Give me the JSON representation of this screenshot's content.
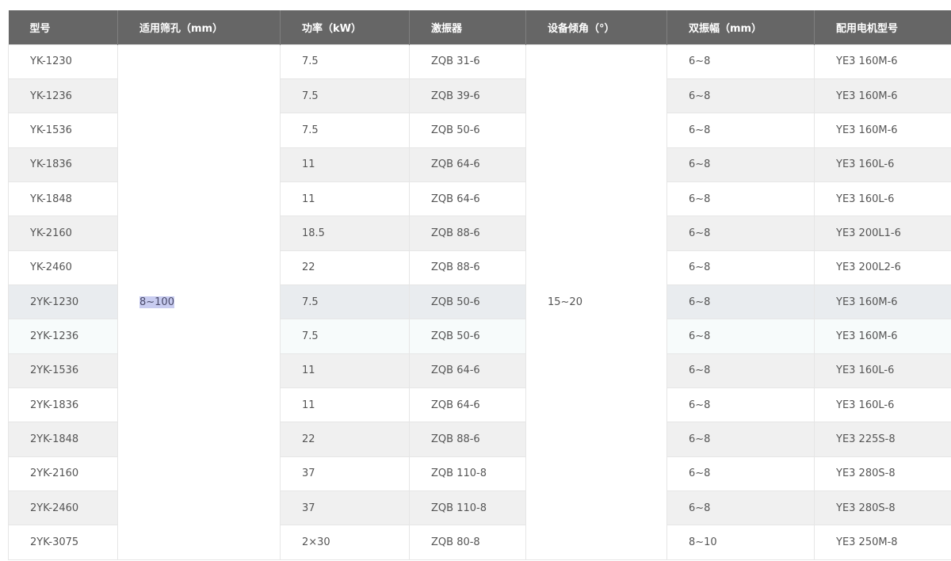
{
  "table": {
    "headers": [
      "型号",
      "适用筛孔（mm）",
      "功率（kW）",
      "激振器",
      "设备倾角（°）",
      "双振幅（mm）",
      "配用电机型号"
    ],
    "merged": {
      "mesh": "8~100",
      "angle": "15~20"
    },
    "rows": [
      {
        "model": "YK-1230",
        "power": "7.5",
        "exciter": "ZQB 31-6",
        "amplitude": "6~8",
        "motor": "YE3 160M-6"
      },
      {
        "model": "YK-1236",
        "power": "7.5",
        "exciter": "ZQB 39-6",
        "amplitude": "6~8",
        "motor": "YE3 160M-6"
      },
      {
        "model": "YK-1536",
        "power": "7.5",
        "exciter": "ZQB 50-6",
        "amplitude": "6~8",
        "motor": "YE3 160M-6"
      },
      {
        "model": "YK-1836",
        "power": "11",
        "exciter": "ZQB 64-6",
        "amplitude": "6~8",
        "motor": "YE3 160L-6"
      },
      {
        "model": "YK-1848",
        "power": "11",
        "exciter": "ZQB 64-6",
        "amplitude": "6~8",
        "motor": "YE3 160L-6"
      },
      {
        "model": "YK-2160",
        "power": "18.5",
        "exciter": "ZQB 88-6",
        "amplitude": "6~8",
        "motor": "YE3 200L1-6"
      },
      {
        "model": "YK-2460",
        "power": "22",
        "exciter": "ZQB 88-6",
        "amplitude": "6~8",
        "motor": "YE3 200L2-6"
      },
      {
        "model": "2YK-1230",
        "power": "7.5",
        "exciter": "ZQB 50-6",
        "amplitude": "6~8",
        "motor": "YE3 160M-6"
      },
      {
        "model": "2YK-1236",
        "power": "7.5",
        "exciter": "ZQB 50-6",
        "amplitude": "6~8",
        "motor": "YE3 160M-6"
      },
      {
        "model": "2YK-1536",
        "power": "11",
        "exciter": "ZQB 64-6",
        "amplitude": "6~8",
        "motor": "YE3 160L-6"
      },
      {
        "model": "2YK-1836",
        "power": "11",
        "exciter": "ZQB 64-6",
        "amplitude": "6~8",
        "motor": "YE3 160L-6"
      },
      {
        "model": "2YK-1848",
        "power": "22",
        "exciter": "ZQB 88-6",
        "amplitude": "6~8",
        "motor": "YE3 225S-8"
      },
      {
        "model": "2YK-2160",
        "power": "37",
        "exciter": "ZQB 110-8",
        "amplitude": "6~8",
        "motor": "YE3 280S-8"
      },
      {
        "model": "2YK-2460",
        "power": "37",
        "exciter": "ZQB 110-8",
        "amplitude": "6~8",
        "motor": "YE3 280S-8"
      },
      {
        "model": "2YK-3075",
        "power": "2×30",
        "exciter": "ZQB 80-8",
        "amplitude": "8~10",
        "motor": "YE3 250M-8"
      }
    ]
  },
  "colors": {
    "header_bg": "#666666",
    "header_text": "#ffffff",
    "row_alt_bg": "#f0f0f0",
    "selection_bg": "#c8ccf0"
  }
}
